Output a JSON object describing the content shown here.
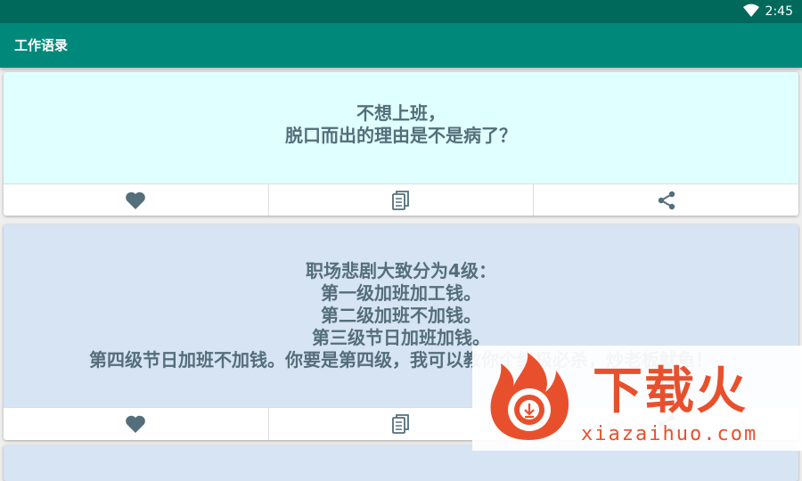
{
  "status_bar": {
    "time": "2:45",
    "icons": [
      "wifi-icon"
    ]
  },
  "app_bar": {
    "title": "工作语录"
  },
  "cards": [
    {
      "lines": [
        "不想上班，",
        "脱口而出的理由是不是病了？"
      ],
      "background": "#e0ffff",
      "actions": [
        "heart-icon",
        "copy-icon",
        "share-icon"
      ]
    },
    {
      "lines": [
        "职场悲剧大致分为4级：",
        "第一级加班加工钱。",
        "第二级加班不加钱。",
        "第三级节日加班加钱。",
        "第四级节日加班不加钱。你要是第四级，我可以教你个终极必杀，炒老板鱿鱼！"
      ],
      "background": "#d6e4f3",
      "actions": [
        "heart-icon",
        "copy-icon",
        "share-icon"
      ]
    }
  ],
  "colors": {
    "status_bar": "#00695c",
    "app_bar": "#00897b",
    "card_text": "#546e7a",
    "icon": "#546e7a",
    "watermark": "#e8502d"
  },
  "watermark": {
    "name": "下载火",
    "url": "xiazaihuo.com"
  }
}
